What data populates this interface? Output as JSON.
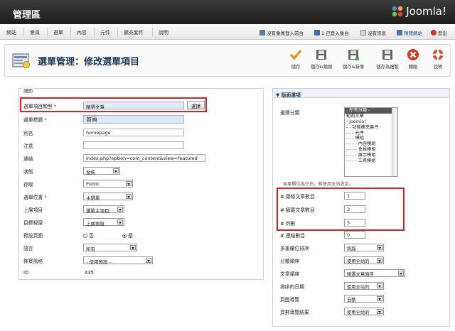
{
  "header": {
    "title": "管理區",
    "logo": "Joomla!"
  },
  "menu": [
    "網站",
    "會員",
    "選單",
    "內容",
    "元件",
    "擴充套件",
    "說明"
  ],
  "status": {
    "frontend": "沒有會員登入前台",
    "backend": "1 已登入後台",
    "messages": "沒有訊息",
    "preview": "預覽網站",
    "logout": "登出"
  },
  "toolbar": {
    "title": "選單管理：修改選單項目",
    "save": "儲存",
    "save_close": "儲存&關閉",
    "save_new": "儲存&新增",
    "save_copy": "儲存為複製",
    "close": "關閉",
    "help": "說明"
  },
  "details": {
    "legend": "細節",
    "type_label": "選單項目類型",
    "type_value": "精選文章",
    "select_btn": "選擇",
    "title_label": "選單標題",
    "title_value": "首頁",
    "alias_label": "別名",
    "alias_value": "homepage",
    "note_label": "注意",
    "note_value": "",
    "link_label": "連結",
    "link_value": "index.php?option=com_content&view=featured",
    "status_label": "狀態",
    "status_value": "發佈",
    "access_label": "存取",
    "access_value": "Public",
    "menu_label": "選單位置",
    "menu_value": "主選單",
    "parent_label": "上層項目",
    "parent_value": "選單主項目",
    "target_label": "目標視窗",
    "target_value": "上層視窗",
    "default_label": "預設頁面",
    "no": "否",
    "yes": "是",
    "lang_label": "語言",
    "lang_value": "所有",
    "style_label": "佈景風格",
    "style_value": "- 使用預設 -",
    "id_label": "ID",
    "id_value": "435"
  },
  "layout": {
    "head": "▼ 版面選項",
    "cat_label": "選擇分類",
    "categories": [
      "- 所有分類 -",
      "範例文章",
      "- Joomla!",
      "- - 功能擴充套件",
      "- - - 元件",
      "- - - 模組",
      "- - - - 內容模組",
      "- - - - 會員模組",
      "- - - - 展示模組",
      "- - - - 工具模組"
    ],
    "note": "如果欄位為空白，將使用全站設定。",
    "leading_label": "# 頭條文章數目",
    "leading_value": "1",
    "intro_label": "# 摘要文章數目",
    "intro_value": "3",
    "columns_label": "# 列數",
    "columns_value": "3",
    "links_label": "# 連結數目",
    "links_value": "0",
    "multi_label": "多重欄位排序",
    "multi_value": "跨越",
    "catorder_label": "分類順序",
    "catorder_value": "使用全站的",
    "artorder_label": "文章順序",
    "artorder_value": "精選文章順序",
    "date_label": "排序的日期",
    "date_value": "使用全站的",
    "pagination_label": "頁面導覽",
    "pagination_value": "自動",
    "pagres_label": "頁數導覽結果",
    "pagres_value": "使用全站的"
  },
  "colors": {
    "highlight": "#e02020",
    "title": "#1a3a5c"
  }
}
